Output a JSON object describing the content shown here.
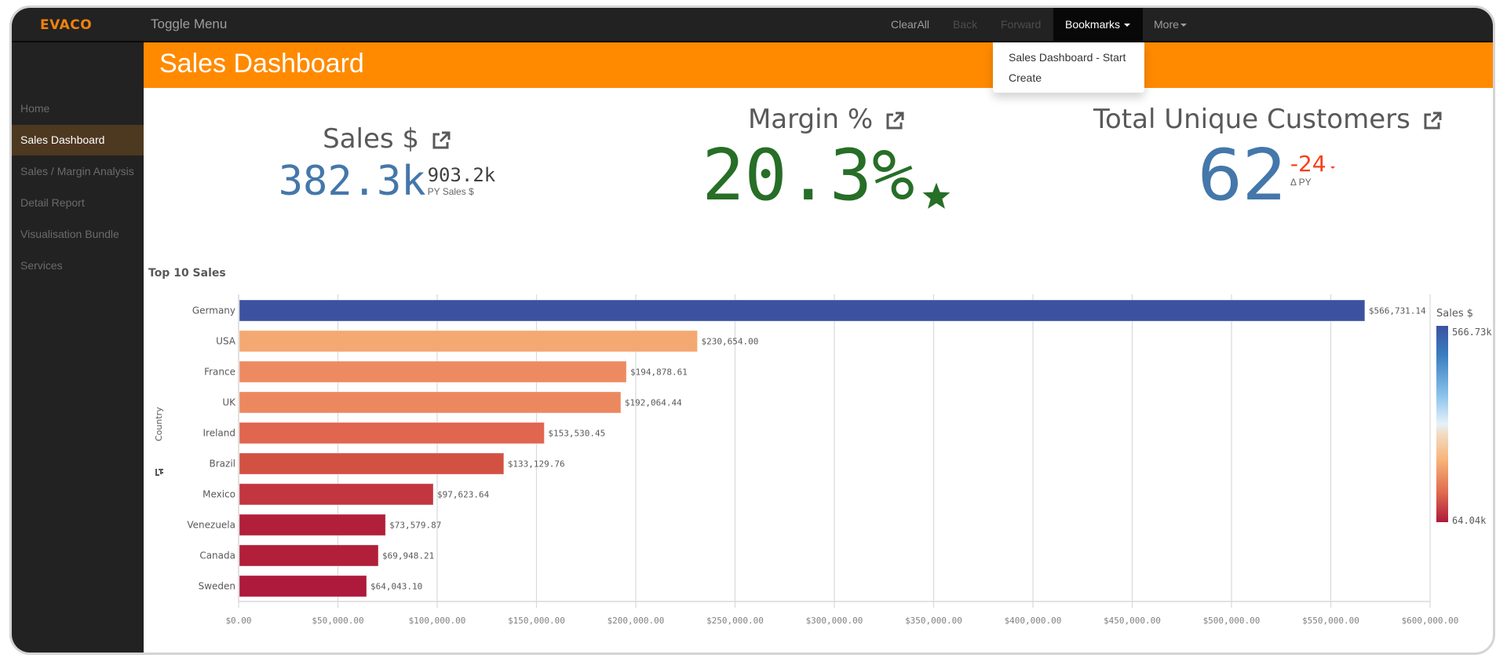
{
  "topbar": {
    "logo": "EVACO",
    "toggle_menu": "Toggle Menu",
    "nav": [
      {
        "label": "ClearAll",
        "state": "enabled"
      },
      {
        "label": "Back",
        "state": "disabled"
      },
      {
        "label": "Forward",
        "state": "disabled"
      },
      {
        "label": "Bookmarks",
        "state": "active",
        "dropdown": true
      },
      {
        "label": "More",
        "state": "enabled",
        "dropdown": true
      }
    ],
    "bookmarks_menu": [
      "Sales Dashboard - Start",
      "Create"
    ]
  },
  "sidebar": {
    "items": [
      {
        "label": "Home",
        "active": false
      },
      {
        "label": "Sales Dashboard",
        "active": true
      },
      {
        "label": "Sales / Margin Analysis",
        "active": false
      },
      {
        "label": "Detail Report",
        "active": false
      },
      {
        "label": "Visualisation Bundle",
        "active": false
      },
      {
        "label": "Services",
        "active": false
      }
    ]
  },
  "page": {
    "title": "Sales Dashboard",
    "accent_color": "#ff8a00"
  },
  "kpis": {
    "sales": {
      "title": "Sales $",
      "value": "382.3k",
      "sub_value": "903.2k",
      "sub_label": "PY Sales $",
      "value_color": "#4477aa"
    },
    "margin": {
      "title": "Margin %",
      "value": "20.3%",
      "indicator": "star-icon",
      "value_color": "#276e27"
    },
    "customers": {
      "title": "Total Unique Customers",
      "value": "62",
      "delta": "-24",
      "delta_label": "Δ PY",
      "value_color": "#4477aa",
      "delta_color": "#f93f17"
    }
  },
  "chart_data": {
    "type": "bar",
    "orientation": "horizontal",
    "title": "Top 10 Sales",
    "ylabel": "Country",
    "xlabel": "",
    "categories": [
      "Germany",
      "USA",
      "France",
      "UK",
      "Ireland",
      "Brazil",
      "Mexico",
      "Venezuela",
      "Canada",
      "Sweden"
    ],
    "values": [
      566731.14,
      230654.0,
      194878.61,
      192064.44,
      153530.45,
      133129.76,
      97623.64,
      73579.87,
      69948.21,
      64043.1
    ],
    "value_labels": [
      "$566,731.14",
      "$230,654.00",
      "$194,878.61",
      "$192,064.44",
      "$153,530.45",
      "$133,129.76",
      "$97,623.64",
      "$73,579.87",
      "$69,948.21",
      "$64,043.10"
    ],
    "xlim": [
      0,
      600000
    ],
    "xticks": [
      0,
      50000,
      100000,
      150000,
      200000,
      250000,
      300000,
      350000,
      400000,
      450000,
      500000,
      550000,
      600000
    ],
    "xtick_labels": [
      "$0.00",
      "$50,000.00",
      "$100,000.00",
      "$150,000.00",
      "$200,000.00",
      "$250,000.00",
      "$300,000.00",
      "$350,000.00",
      "$400,000.00",
      "$450,000.00",
      "$500,000.00",
      "$550,000.00",
      "$600,000.00"
    ],
    "grid": true,
    "legend": {
      "title": "Sales $",
      "max_label": "566.73k",
      "min_label": "64.04k",
      "placement": "right",
      "type": "color-gradient"
    },
    "colors": [
      "#3c52a0",
      "#f4a872",
      "#ee8a62",
      "#ec885f",
      "#e0664f",
      "#d25142",
      "#c3353f",
      "#b11f3a",
      "#b11f3a",
      "#ad1a3b"
    ]
  }
}
